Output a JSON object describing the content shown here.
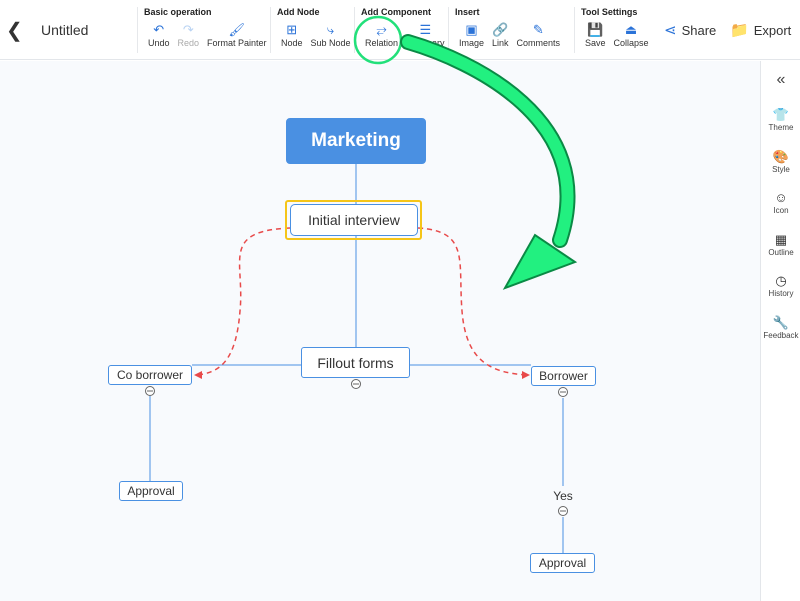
{
  "header": {
    "back_icon": "chevron-left-icon",
    "title": "Untitled",
    "share": "Share",
    "export": "Export"
  },
  "toolbar": {
    "groups": [
      {
        "title": "Basic operation",
        "buttons": [
          {
            "label": "Undo",
            "icon": "↶"
          },
          {
            "label": "Redo",
            "icon": "↷",
            "disabled": true
          },
          {
            "label": "Format Painter",
            "icon": "🖌"
          }
        ]
      },
      {
        "title": "Add Node",
        "buttons": [
          {
            "label": "Node",
            "icon": "⊞"
          },
          {
            "label": "Sub Node",
            "icon": "⤷"
          }
        ]
      },
      {
        "title": "Add Component",
        "buttons": [
          {
            "label": "Relation",
            "icon": "⥂"
          },
          {
            "label": "Summary",
            "icon": "☰"
          }
        ]
      },
      {
        "title": "Insert",
        "buttons": [
          {
            "label": "Image",
            "icon": "▣"
          },
          {
            "label": "Link",
            "icon": "🔗"
          },
          {
            "label": "Comments",
            "icon": "✎"
          }
        ]
      },
      {
        "title": "Tool Settings",
        "buttons": [
          {
            "label": "Save",
            "icon": "💾"
          },
          {
            "label": "Collapse",
            "icon": "⏏"
          }
        ]
      }
    ]
  },
  "sidebar": {
    "collapse_icon": "«",
    "items": [
      {
        "label": "Theme",
        "icon": "👕"
      },
      {
        "label": "Style",
        "icon": "🎨"
      },
      {
        "label": "Icon",
        "icon": "☺"
      },
      {
        "label": "Outline",
        "icon": "▦"
      },
      {
        "label": "History",
        "icon": "◷"
      },
      {
        "label": "Feedback",
        "icon": "🔧"
      }
    ]
  },
  "mindmap": {
    "root": "Marketing",
    "n1": "Initial interview",
    "n2": "Fillout forms",
    "left": "Co borrower",
    "right": "Borrower",
    "left_child": "Approval",
    "right_label": "Yes",
    "right_child": "Approval"
  },
  "colors": {
    "accent": "#2b73d8",
    "root": "#4a90e2",
    "relation": "#e84a4a",
    "highlight": "#f5c518",
    "annotation": "#22e07a"
  }
}
